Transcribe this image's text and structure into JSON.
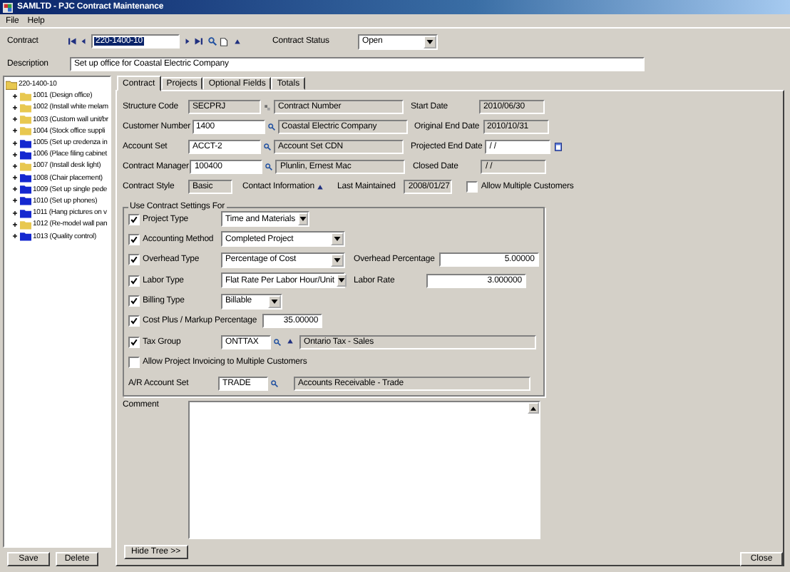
{
  "window": {
    "title": "SAMLTD - PJC Contract Maintenance"
  },
  "menu": [
    "File",
    "Help"
  ],
  "header": {
    "contract": {
      "label": "Contract",
      "value": "220-1400-10"
    },
    "status": {
      "label": "Contract Status",
      "value": "Open"
    },
    "description": {
      "label": "Description",
      "value": "Set up office for Coastal Electric Company"
    }
  },
  "tree": {
    "label": "220-1400-10",
    "children": [
      {
        "label": "1001 (Design office)",
        "color": "#e8c850",
        "expanded": false
      },
      {
        "label": "1002 (Install white melam",
        "color": "#e8c850",
        "expanded": false
      },
      {
        "label": "1003 (Custom wall unit/br",
        "color": "#e8c850",
        "expanded": false
      },
      {
        "label": "1004 (Stock office suppli",
        "color": "#e8c850",
        "expanded": false
      },
      {
        "label": "1005 (Set up credenza in",
        "color": "#1428d0",
        "expanded": false
      },
      {
        "label": "1006 (Place filing cabinet",
        "color": "#1428d0",
        "expanded": false
      },
      {
        "label": "1007 (Install desk light)",
        "color": "#e8c850",
        "expanded": false
      },
      {
        "label": "1008 (Chair placement)",
        "color": "#1428d0",
        "expanded": false
      },
      {
        "label": "1009 (Set up single pede",
        "color": "#1428d0",
        "expanded": false
      },
      {
        "label": "1010 (Set up phones)",
        "color": "#1428d0",
        "expanded": false
      },
      {
        "label": "1011 (Hang pictures on v",
        "color": "#1428d0",
        "expanded": false
      },
      {
        "label": "1012 (Re-model wall pan",
        "color": "#e8c850",
        "expanded": false
      },
      {
        "label": "1013 (Quality control)",
        "color": "#1428d0",
        "expanded": false
      }
    ]
  },
  "tabs": [
    {
      "label": "Contract",
      "selected": true
    },
    {
      "label": "Projects",
      "selected": false
    },
    {
      "label": "Optional Fields",
      "selected": false
    },
    {
      "label": "Totals",
      "selected": false
    }
  ],
  "rows": [
    {
      "label": "Structure Code",
      "value": "SECPRJ",
      "editable": false,
      "kind": "finder",
      "description": "Contract Number",
      "side": {
        "label": "Start Date",
        "value": "2010/06/30",
        "editable": false
      }
    },
    {
      "label": "Customer Number",
      "value": "1400",
      "editable": true,
      "kind": "lookup",
      "description": "Coastal Electric Company",
      "side": {
        "label": "Original End Date",
        "value": "2010/10/31",
        "editable": false
      }
    },
    {
      "label": "Account Set",
      "value": "ACCT-2",
      "editable": true,
      "kind": "lookup",
      "description": "Account Set CDN",
      "side": {
        "label": "Projected End Date",
        "value": " / /",
        "editable": true,
        "calendar": true
      }
    },
    {
      "label": "Contract Manager",
      "value": "100400",
      "editable": true,
      "kind": "lookup",
      "description": "Plunlin, Ernest Mac",
      "side": {
        "label": "Closed Date",
        "value": " / /",
        "editable": false
      }
    }
  ],
  "style_row": {
    "label": "Contract Style",
    "value": "Basic",
    "contact_label": "Contact Information",
    "maintained_label": "Last Maintained",
    "maintained_value": "2008/01/27",
    "allow_multiple": {
      "label": "Allow Multiple Customers",
      "checked": false
    }
  },
  "settings": {
    "title": "Use Contract Settings For",
    "items": [
      {
        "kind": "dropdown",
        "label": "Project Type",
        "checked": true,
        "value": "Time and Materials"
      },
      {
        "kind": "dropdown",
        "label": "Accounting Method",
        "checked": true,
        "value": "Completed Project"
      },
      {
        "kind": "dropdown",
        "label": "Overhead Type",
        "checked": true,
        "value": "Percentage of Cost",
        "extra": {
          "label": "Overhead Percentage",
          "value": "5.00000"
        }
      },
      {
        "kind": "dropdown",
        "label": "Labor Type",
        "checked": true,
        "value": "Flat Rate Per Labor Hour/Unit",
        "extra": {
          "label": "Labor Rate",
          "value": "3.000000"
        }
      },
      {
        "kind": "dropdown",
        "label": "Billing Type",
        "checked": true,
        "value": "Billable"
      },
      {
        "kind": "number",
        "label": "Cost Plus / Markup Percentage",
        "checked": true,
        "value": "35.00000"
      },
      {
        "kind": "lookup",
        "label": "Tax Group",
        "checked": true,
        "value": "ONTTAX",
        "description": "Ontario Tax - Sales"
      },
      {
        "kind": "checkbox",
        "label": "Allow Project Invoicing to Multiple Customers",
        "checked": false
      }
    ]
  },
  "ar_account": {
    "label": "A/R Account Set",
    "value": "TRADE",
    "description": "Accounts Receivable - Trade"
  },
  "comment": {
    "label": "Comment"
  },
  "hide_tree": "Hide Tree >>",
  "buttons": [
    "Save",
    "Delete"
  ],
  "close": "Close"
}
